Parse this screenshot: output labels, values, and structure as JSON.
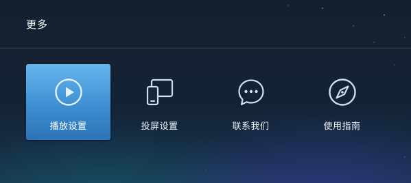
{
  "header": {
    "title": "更多"
  },
  "menu": {
    "items": [
      {
        "label": "播放设置",
        "icon": "play-icon",
        "selected": true
      },
      {
        "label": "投屏设置",
        "icon": "screen-cast-icon",
        "selected": false
      },
      {
        "label": "联系我们",
        "icon": "chat-icon",
        "selected": false
      },
      {
        "label": "使用指南",
        "icon": "compass-icon",
        "selected": false
      }
    ]
  },
  "colors": {
    "selected_tile": "#4a9ee0",
    "icon": "#cfe0ee",
    "text": "#ffffff"
  }
}
